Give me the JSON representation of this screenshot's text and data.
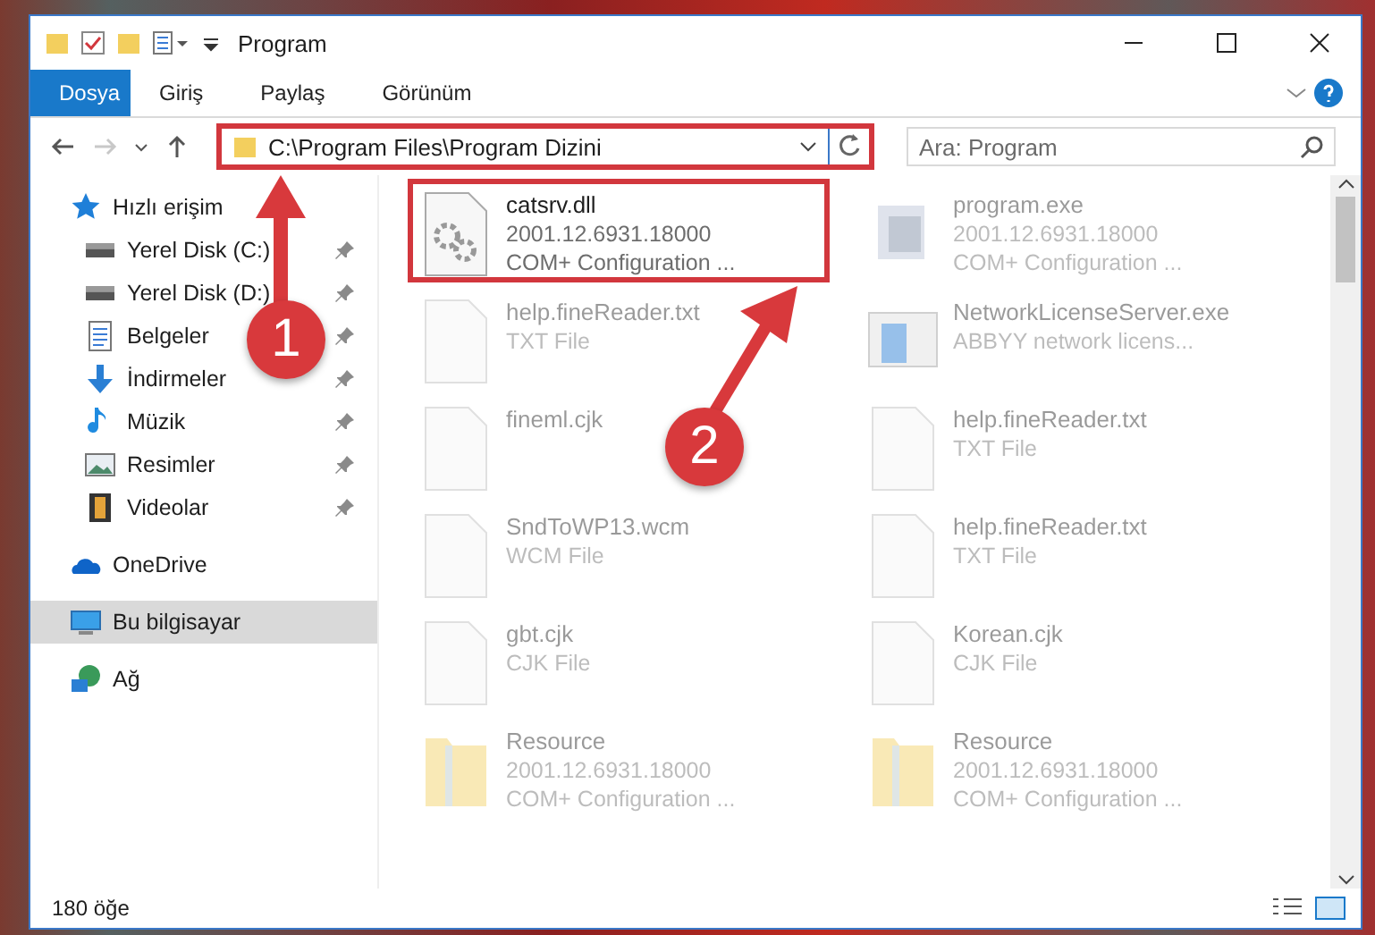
{
  "window": {
    "title": "Program"
  },
  "ribbon": {
    "tabs": [
      {
        "label": "Dosya",
        "kind": "file"
      },
      {
        "label": "Giriş",
        "kind": "tab"
      },
      {
        "label": "Paylaş",
        "kind": "tab"
      },
      {
        "label": "Görünüm",
        "kind": "tab"
      }
    ]
  },
  "address_bar": {
    "path": "C:\\Program Files\\Program Dizini",
    "highlighted": true,
    "forward_disabled": true
  },
  "search": {
    "placeholder": "Ara: Program"
  },
  "sidebar": {
    "items": [
      {
        "label": "Hızlı erişim",
        "kind": "star",
        "selected": false,
        "children": [
          {
            "label": "Yerel Disk (C:)",
            "kind": "drive",
            "pinned": true,
            "selected": false
          },
          {
            "label": "Yerel Disk (D:)",
            "kind": "drive",
            "pinned": true,
            "selected": false
          },
          {
            "label": "Belgeler",
            "kind": "document",
            "pinned": true,
            "selected": false
          },
          {
            "label": "İndirmeler",
            "kind": "download",
            "pinned": true,
            "selected": false
          },
          {
            "label": "Müzik",
            "kind": "music",
            "pinned": true,
            "selected": false
          },
          {
            "label": "Resimler",
            "kind": "picture",
            "pinned": true,
            "selected": false
          },
          {
            "label": "Videolar",
            "kind": "film",
            "pinned": true,
            "selected": false
          }
        ]
      },
      {
        "label": "OneDrive",
        "kind": "cloud",
        "selected": false
      },
      {
        "label": "Bu bilgisayar",
        "kind": "computer",
        "selected": true
      },
      {
        "label": "Ağ",
        "kind": "network",
        "selected": false
      }
    ]
  },
  "files": [
    {
      "name": "catsrv.dll",
      "details": [
        "2001.12.6931.18000",
        "COM+ Configuration ..."
      ],
      "kind": "gear-file",
      "highlighted": true,
      "faded": false
    },
    {
      "name": "program.exe",
      "details": [
        "2001.12.6931.18000",
        "COM+ Configuration ..."
      ],
      "kind": "app",
      "highlighted": false,
      "faded": true
    },
    {
      "name": "help.fineReader.txt",
      "details": [
        "TXT File"
      ],
      "kind": "file",
      "highlighted": false,
      "faded": true
    },
    {
      "name": "NetworkLicenseServer.exe",
      "details": [
        "ABBYY network licens..."
      ],
      "kind": "window",
      "highlighted": false,
      "faded": true
    },
    {
      "name": "fineml.cjk",
      "kind": "file",
      "highlighted": false,
      "faded": true
    },
    {
      "name": "help.fineReader.txt",
      "details": [
        "TXT File"
      ],
      "kind": "file",
      "highlighted": false,
      "faded": true
    },
    {
      "name": "SndToWP13.wcm",
      "details": [
        "WCM File"
      ],
      "kind": "file",
      "highlighted": false,
      "faded": true
    },
    {
      "name": "help.fineReader.txt",
      "details": [
        "TXT File"
      ],
      "kind": "file",
      "highlighted": false,
      "faded": true
    },
    {
      "name": "gbt.cjk",
      "details": [
        "CJK File"
      ],
      "kind": "file",
      "highlighted": false,
      "faded": true
    },
    {
      "name": "Korean.cjk",
      "details": [
        "CJK File"
      ],
      "kind": "file",
      "highlighted": false,
      "faded": true
    },
    {
      "name": "Resource",
      "details": [
        "2001.12.6931.18000",
        "COM+ Configuration ..."
      ],
      "kind": "folder",
      "highlighted": false,
      "faded": true
    },
    {
      "name": "Resource",
      "details": [
        "2001.12.6931.18000",
        "COM+ Configuration ..."
      ],
      "kind": "folder",
      "highlighted": false,
      "faded": true
    }
  ],
  "status_bar": {
    "count": "180 öğe"
  },
  "annotations": [
    {
      "label": "1"
    },
    {
      "label": "2"
    }
  ]
}
